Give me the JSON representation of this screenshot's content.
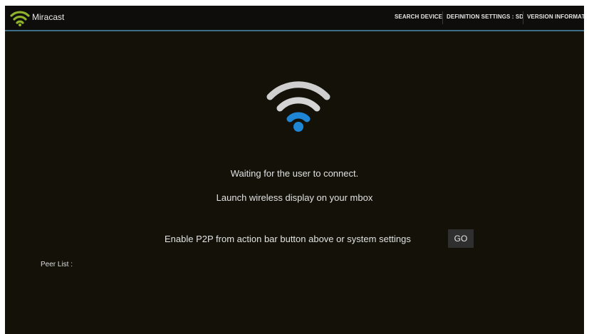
{
  "action_bar": {
    "app_title": "Miracast",
    "app_icon": "wifi-signal-icon",
    "items": [
      {
        "label": "SEARCH DEVICE"
      },
      {
        "label": "DEFINITION SETTINGS : SD"
      },
      {
        "label": "VERSION INFORMATION"
      }
    ]
  },
  "main": {
    "status_icon": "wifi-icon",
    "waiting_text": "Waiting for the user to connect.",
    "launch_text": "Launch wireless display on your mbox",
    "p2p_text": "Enable P2P from action bar button above or system settings",
    "go_label": "GO",
    "peer_list_label": "Peer List :"
  },
  "colors": {
    "background": "#131108",
    "action_bar": "#0e0d0b",
    "accent_line": "#3d6f86",
    "wifi_blue": "#1f86d6",
    "wifi_gray": "#cfcfcf",
    "app_icon_green": "#8fb32a"
  }
}
